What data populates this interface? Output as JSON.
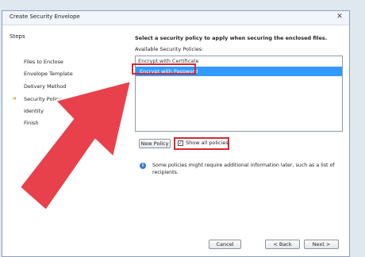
{
  "window": {
    "title": "Create Security Envelope",
    "close_symbol": "✕"
  },
  "sidebar": {
    "title": "Steps",
    "items": [
      {
        "label": "Files to Enclose"
      },
      {
        "label": "Envelope Template"
      },
      {
        "label": "Delivery Method"
      },
      {
        "label": "Security Policy",
        "current": true
      },
      {
        "label": "Identity"
      },
      {
        "label": "Finish"
      }
    ],
    "current_marker": "➜"
  },
  "main": {
    "heading": "Select a security policy to apply when securing the enclosed files.",
    "available_label": "Available Security Policies:",
    "policies": [
      {
        "label": "Encrypt with Certificate",
        "selected": false
      },
      {
        "label": "Encrypt with Password",
        "selected": true
      }
    ],
    "new_policy_button": "New Policy",
    "show_all_label": "Show all policies",
    "show_all_checked": true,
    "check_mark": "✓",
    "info_icon": "i",
    "info_text": "Some policies might require additional information later, such as a list of recipients."
  },
  "footer": {
    "cancel_button": "Cancel",
    "back_button": "< Back",
    "next_button": "Next >"
  },
  "colors": {
    "selection": "#3399ff",
    "highlight_red": "#d6282f",
    "arrow_red": "#e8414c"
  }
}
